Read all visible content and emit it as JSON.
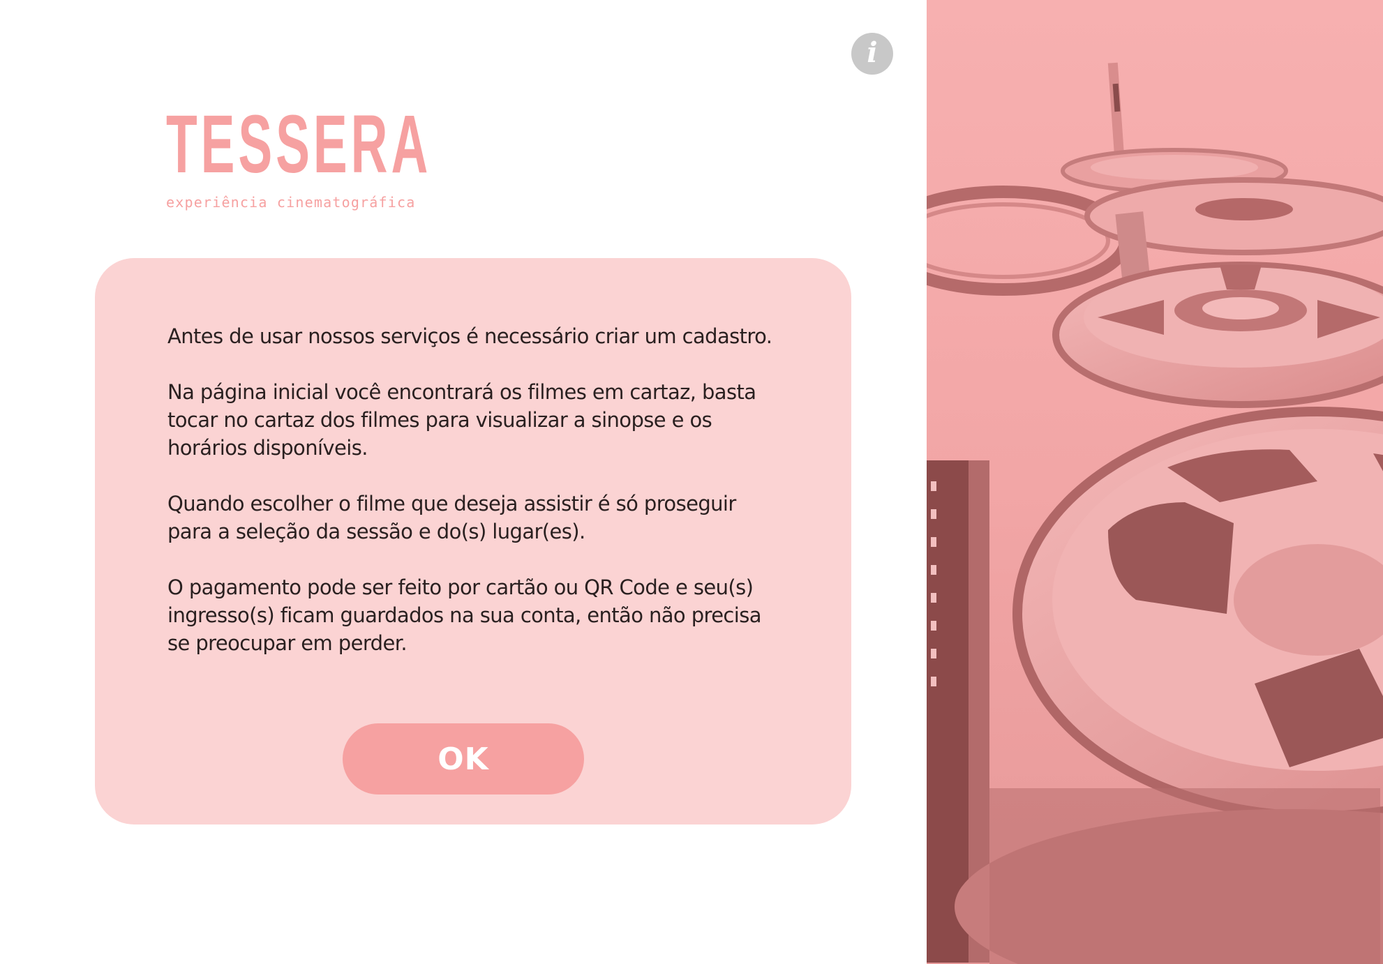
{
  "header": {
    "info_icon": "info-icon",
    "info_glyph": "i"
  },
  "logo": {
    "wordmark": "TESSERA",
    "tagline": "experiência cinematográfica"
  },
  "dialog": {
    "paragraphs": [
      "Antes de usar nossos serviços é necessário criar um cadastro.",
      "Na página inicial você encontrará os filmes em cartaz, basta tocar no cartaz dos filmes para visualizar a sinopse e os horários disponíveis.",
      "Quando escolher o filme que deseja assistir é só proseguir para a seleção da sessão e do(s) lugar(es).",
      "O pagamento pode ser feito por cartão ou QR Code e seu(s) ingresso(s) ficam guardados na sua conta, então não precisa se preocupar em perder."
    ],
    "ok_label": "OK"
  },
  "colors": {
    "brand_pink": "#f6a1a1",
    "card_bg": "#fbd3d3",
    "photo_tint": "#f6acac",
    "info_gray": "#c8c8c8",
    "text": "#2a2020"
  }
}
